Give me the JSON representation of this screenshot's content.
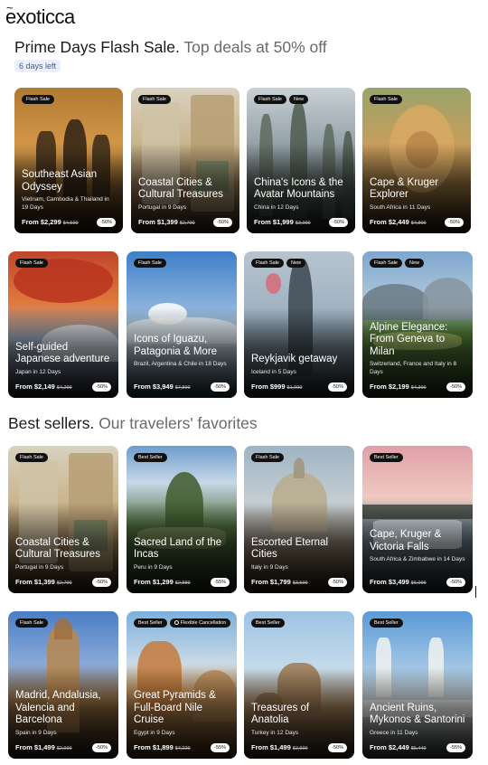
{
  "brand": {
    "name": "exoticca",
    "tilde": "~"
  },
  "flash": {
    "title": "Prime Days Flash Sale.",
    "subtitle": "Top deals at 50% off",
    "days_left": "6 days left",
    "cards": [
      {
        "badges": [
          "Flash Sale"
        ],
        "title_lines": [
          "Southeast Asian",
          "Odyssey"
        ],
        "sub": "Vietnam, Cambodia & Thailand in 19 Days",
        "price": "From $2,299",
        "old": "$4,599",
        "disc": "-50%",
        "scene": "temple"
      },
      {
        "badges": [
          "Flash Sale"
        ],
        "title_lines": [
          "Coastal Cities &",
          "Cultural Treasures"
        ],
        "sub": "Portugal in 9 Days",
        "price": "From $1,399",
        "old": "$2,799",
        "disc": "-50%",
        "scene": "lisbon"
      },
      {
        "badges": [
          "Flash Sale",
          "New"
        ],
        "title_lines": [
          "China's Icons & the",
          "Avatar Mountains"
        ],
        "sub": "China in 12 Days",
        "price": "From $1,999",
        "old": "$3,999",
        "disc": "-50%",
        "scene": "pillars"
      },
      {
        "badges": [
          "Flash Sale"
        ],
        "title_lines": [
          "Cape & Kruger",
          "Explorer"
        ],
        "sub": "South Africa in 11 Days",
        "price": "From $2,449",
        "old": "$4,899",
        "disc": "-50%",
        "scene": "lion"
      },
      {
        "badges": [
          "Flash Sale"
        ],
        "title_lines": [
          "Self-guided",
          "Japanese adventure"
        ],
        "sub": "Japan in 12 Days",
        "price": "From $2,149",
        "old": "$4,299",
        "disc": "-50%",
        "scene": "fuji"
      },
      {
        "badges": [
          "Flash Sale"
        ],
        "title_lines": [
          "Icons of Iguazu,",
          "Patagonia & More"
        ],
        "sub": "Brazil, Argentina & Chile in 18 Days",
        "price": "From $3,949",
        "old": "$7,899",
        "disc": "-50%",
        "scene": "glacier"
      },
      {
        "badges": [
          "Flash Sale",
          "New"
        ],
        "title_lines": [
          "Reykjavik getaway"
        ],
        "sub": "Iceland in 5 Days",
        "price": "From $999",
        "old": "$1,999",
        "disc": "-50%",
        "scene": "geyser"
      },
      {
        "badges": [
          "Flash Sale",
          "New"
        ],
        "title_lines": [
          "Alpine Elegance:",
          "From Geneva to",
          "Milan"
        ],
        "sub": "Switzerland, France and Italy in 8 Days",
        "price": "From $2,199",
        "old": "$4,399",
        "disc": "-50%",
        "scene": "alps"
      }
    ]
  },
  "best": {
    "title": "Best sellers.",
    "subtitle": "Our travelers' favorites",
    "cards": [
      {
        "badges": [
          "Flash Sale"
        ],
        "title_lines": [
          "Coastal Cities &",
          "Cultural Treasures"
        ],
        "sub": "Portugal in 9 Days",
        "price": "From $1,399",
        "old": "$2,799",
        "disc": "-50%",
        "scene": "lisbon"
      },
      {
        "badges": [
          "Best Seller"
        ],
        "title_lines": [
          "Sacred Land of the",
          "Incas"
        ],
        "sub": "Peru in 9 Days",
        "price": "From $1,299",
        "old": "$2,889",
        "disc": "-55%",
        "scene": "machu"
      },
      {
        "badges": [
          "Flash Sale"
        ],
        "title_lines": [
          "Escorted Eternal",
          "Cities"
        ],
        "sub": "Italy in 9 Days",
        "price": "From $1,799",
        "old": "$3,599",
        "disc": "-50%",
        "scene": "dome"
      },
      {
        "badges": [
          "Best Seller"
        ],
        "title_lines": [
          "Cape, Kruger &",
          "Victoria Falls"
        ],
        "sub": "South Africa & Zimbabwe in 14 Days",
        "price": "From $3,499",
        "old": "$6,999",
        "disc": "-50%",
        "scene": "falls"
      },
      {
        "badges": [
          "Flash Sale"
        ],
        "title_lines": [
          "Madrid, Andalusia,",
          "Valencia and",
          "Barcelona"
        ],
        "sub": "Spain in 9 Days",
        "price": "From $1,499",
        "old": "$2,999",
        "disc": "-50%",
        "scene": "tower"
      },
      {
        "badges": [
          "Best Seller",
          "Flexible Cancellation"
        ],
        "title_lines": [
          "Great Pyramids &",
          "Full-Board Nile",
          "Cruise"
        ],
        "sub": "Egypt in 9 Days",
        "price": "From $1,899",
        "old": "$4,229",
        "disc": "-55%",
        "scene": "sphinx"
      },
      {
        "badges": [
          "Best Seller"
        ],
        "title_lines": [
          "Treasures of",
          "Anatolia"
        ],
        "sub": "Turkey in 12 Days",
        "price": "From $1,499",
        "old": "$2,999",
        "disc": "-50%",
        "scene": "cappadocia"
      },
      {
        "badges": [
          "Best Seller"
        ],
        "title_lines": [
          "Ancient Ruins,",
          "Mykonos & Santorini"
        ],
        "sub": "Greece in 11 Days",
        "price": "From $2,449",
        "old": "$5,449",
        "disc": "-55%",
        "scene": "windmills"
      }
    ]
  }
}
